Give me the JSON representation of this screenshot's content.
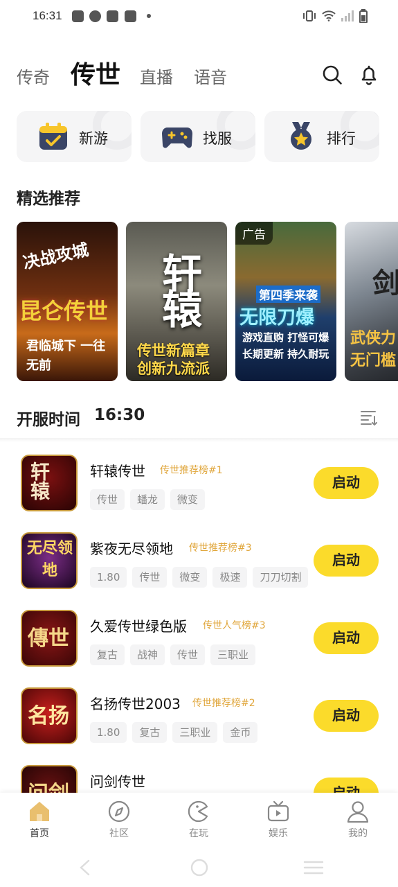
{
  "status_bar": {
    "time": "16:31"
  },
  "top_nav": {
    "tabs": [
      {
        "label": "传奇",
        "active": false
      },
      {
        "label": "传世",
        "active": true
      },
      {
        "label": "直播",
        "active": false
      },
      {
        "label": "语音",
        "active": false
      }
    ],
    "icons": [
      "search-icon",
      "bell-icon"
    ]
  },
  "quick_links": [
    {
      "label": "新游",
      "icon": "calendar-check-icon"
    },
    {
      "label": "找服",
      "icon": "gamepad-icon"
    },
    {
      "label": "排行",
      "icon": "medal-icon"
    }
  ],
  "featured": {
    "title": "精选推荐",
    "cards": [
      {
        "lines": [
          "决战攻城",
          "昆仑传世",
          "君临城下 一往无前"
        ],
        "ad": ""
      },
      {
        "lines": [
          "轩辕",
          "传世新篇章",
          "创新九流派"
        ],
        "ad": ""
      },
      {
        "lines": [
          "第四季来袭",
          "无限刀爆",
          "游戏直购 打怪可爆",
          "长期更新 持久耐玩"
        ],
        "ad": "广告"
      },
      {
        "lines": [
          "剑",
          "武侠力",
          "无门槛"
        ],
        "ad": ""
      }
    ]
  },
  "server_section": {
    "title": "开服时间",
    "time": "16:30"
  },
  "games": [
    {
      "name": "轩辕传世",
      "rank": "传世推荐榜#1",
      "tags": [
        "传世",
        "蟠龙",
        "微变"
      ],
      "button": "启动",
      "icon_text": "轩辕"
    },
    {
      "name": "紫夜无尽领地",
      "rank": "传世推荐榜#3",
      "tags": [
        "1.80",
        "传世",
        "微变",
        "极速",
        "刀刀切割"
      ],
      "button": "启动",
      "icon_text": "无尽领地"
    },
    {
      "name": "久爱传世绿色版",
      "rank": "传世人气榜#3",
      "tags": [
        "复古",
        "战神",
        "传世",
        "三职业"
      ],
      "button": "启动",
      "icon_text": "傳世"
    },
    {
      "name": "名扬传世2003",
      "rank": "传世推荐榜#2",
      "tags": [
        "1.80",
        "复古",
        "三职业",
        "金币"
      ],
      "button": "启动",
      "icon_text": "名扬"
    },
    {
      "name": "问剑传世",
      "rank": "",
      "tags": [],
      "button": "启动",
      "icon_text": "问剑"
    }
  ],
  "tabbar": [
    {
      "label": "首页",
      "icon": "home-icon",
      "active": true
    },
    {
      "label": "社区",
      "icon": "compass-icon",
      "active": false
    },
    {
      "label": "在玩",
      "icon": "pacman-icon",
      "active": false
    },
    {
      "label": "娱乐",
      "icon": "tv-icon",
      "active": false
    },
    {
      "label": "我的",
      "icon": "user-icon",
      "active": false
    }
  ],
  "colors": {
    "accent": "#fbdb2b",
    "rank": "#e0a63b",
    "tag_bg": "#f4f4f5"
  }
}
